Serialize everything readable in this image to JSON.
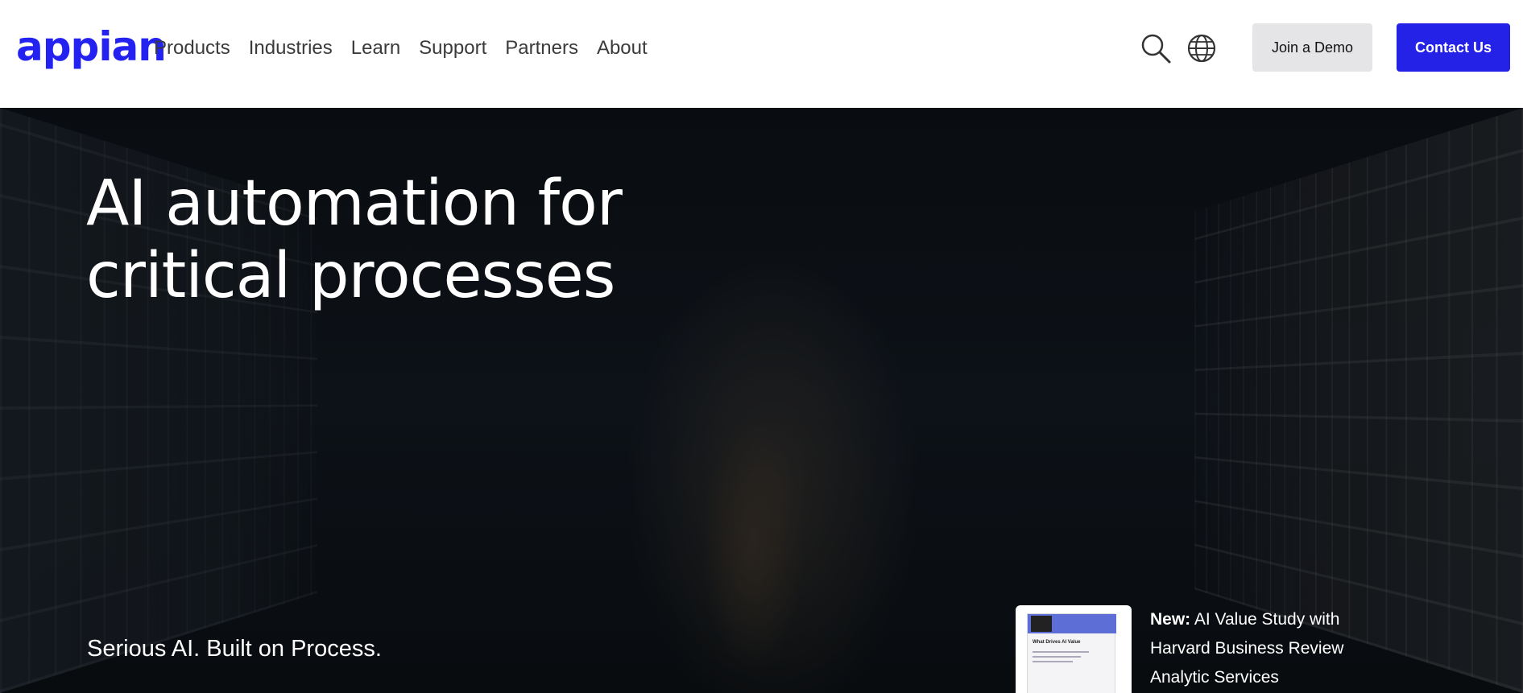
{
  "brand": {
    "logo_text": "appian",
    "accent_color": "#2322f0"
  },
  "nav": {
    "items": [
      {
        "label": "Products"
      },
      {
        "label": "Industries"
      },
      {
        "label": "Learn"
      },
      {
        "label": "Support"
      },
      {
        "label": "Partners"
      },
      {
        "label": "About"
      }
    ]
  },
  "header": {
    "search_icon": "search-icon",
    "globe_icon": "globe-icon",
    "demo_button": "Join a Demo",
    "contact_button": "Contact Us",
    "contact_color": "#2322e6"
  },
  "hero": {
    "title_line1": "AI automation for",
    "title_line2": "critical processes",
    "tagline": "Serious AI. Built on Process.",
    "promo": {
      "badge": "New:",
      "text": " AI Value Study with Harvard Business Review Analytic Services",
      "thumb_title": "What Drives AI Value"
    }
  }
}
